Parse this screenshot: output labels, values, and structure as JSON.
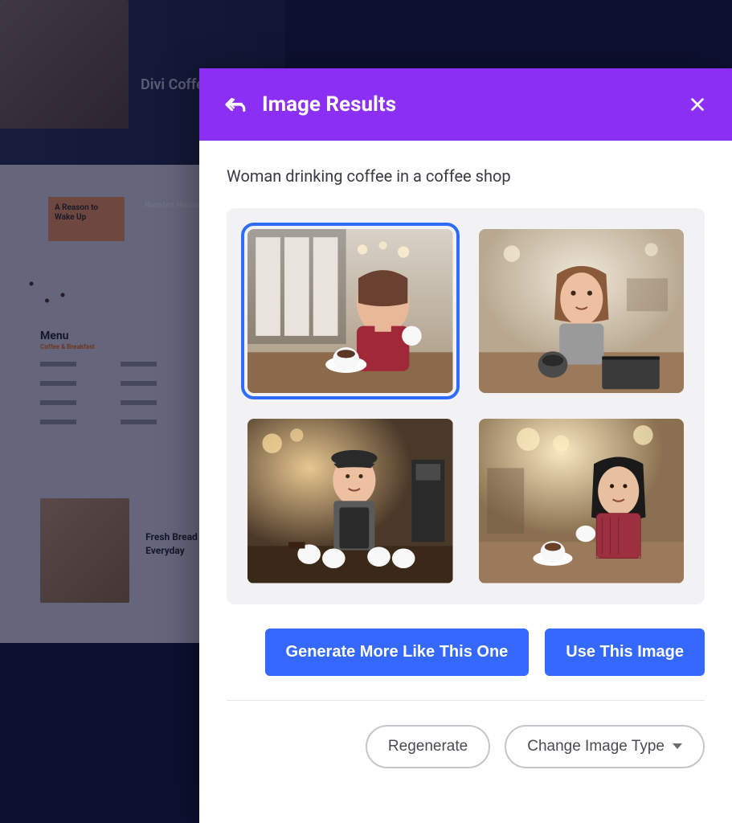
{
  "background": {
    "hero_title": "Divi Coffee Shop",
    "orange_box": "A Reason to Wake Up",
    "roasted": "Roasted House",
    "menu_title": "Menu",
    "menu_sub": "Coffee & Breakfast",
    "bread_text": "Fresh Bread Baked in House Everyday"
  },
  "modal": {
    "title": "Image Results",
    "prompt": "Woman drinking coffee in a coffee shop",
    "buttons": {
      "generate_more": "Generate More Like This One",
      "use_image": "Use This Image",
      "regenerate": "Regenerate",
      "change_type": "Change Image Type"
    }
  }
}
